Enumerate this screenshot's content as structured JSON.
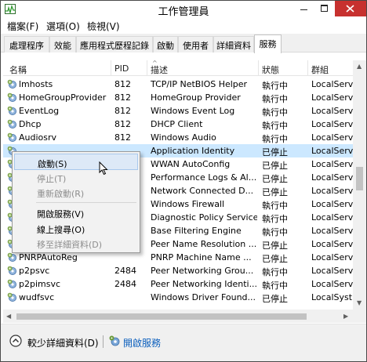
{
  "window": {
    "title": "工作管理員"
  },
  "menu": [
    "檔案(F)",
    "選項(O)",
    "檢視(V)"
  ],
  "tabs": [
    "處理程序",
    "效能",
    "應用程式歷程記錄",
    "啟動",
    "使用者",
    "詳細資料",
    "服務"
  ],
  "active_tab": "服務",
  "columns": {
    "name": "名稱",
    "pid": "PID",
    "description": "描述",
    "status": "狀態",
    "group": "群組"
  },
  "services": [
    {
      "name": "lmhosts",
      "pid": "812",
      "description": "TCP/IP NetBIOS Helper",
      "status": "執行中",
      "group": "LocalServi"
    },
    {
      "name": "HomeGroupProvider",
      "pid": "812",
      "description": "HomeGroup Provider",
      "status": "執行中",
      "group": "LocalServi"
    },
    {
      "name": "EventLog",
      "pid": "812",
      "description": "Windows Event Log",
      "status": "執行中",
      "group": "LocalServi"
    },
    {
      "name": "Dhcp",
      "pid": "812",
      "description": "DHCP Client",
      "status": "執行中",
      "group": "LocalServi"
    },
    {
      "name": "Audiosrv",
      "pid": "812",
      "description": "Windows Audio",
      "status": "執行中",
      "group": "LocalServi"
    },
    {
      "name": "",
      "pid": "",
      "description": "Application Identity",
      "status": "已停止",
      "group": "LocalServi"
    },
    {
      "name": "",
      "pid": "",
      "description": "WWAN AutoConfig",
      "status": "已停止",
      "group": "LocalServi"
    },
    {
      "name": "",
      "pid": "",
      "description": "Performance Logs & Al...",
      "status": "已停止",
      "group": "LocalServi"
    },
    {
      "name": "",
      "pid": "",
      "description": "Network Connected D...",
      "status": "已停止",
      "group": "LocalServi"
    },
    {
      "name": "",
      "pid": "",
      "description": "Windows Firewall",
      "status": "執行中",
      "group": "LocalServi"
    },
    {
      "name": "",
      "pid": "",
      "description": "Diagnostic Policy Service",
      "status": "執行中",
      "group": "LocalServi"
    },
    {
      "name": "",
      "pid": "",
      "description": "Base Filtering Engine",
      "status": "執行中",
      "group": "LocalServi"
    },
    {
      "name": "",
      "pid": "",
      "description": "Peer Name Resolution ...",
      "status": "已停止",
      "group": "LocalServi"
    },
    {
      "name": "PNRPAutoReg",
      "pid": "",
      "description": "PNRP Machine Name ...",
      "status": "已停止",
      "group": "LocalServi"
    },
    {
      "name": "p2psvc",
      "pid": "2484",
      "description": "Peer Networking Grou...",
      "status": "執行中",
      "group": "LocalServi"
    },
    {
      "name": "p2pimsvc",
      "pid": "2484",
      "description": "Peer Networking Identi...",
      "status": "執行中",
      "group": "LocalServi"
    },
    {
      "name": "wudfsvc",
      "pid": "",
      "description": "Windows Driver Found...",
      "status": "已停止",
      "group": "LocalSyst..."
    }
  ],
  "selected_row_index": 5,
  "context_menu": {
    "items": [
      {
        "label": "啟動(S)",
        "enabled": true,
        "highlighted": true
      },
      {
        "label": "停止(T)",
        "enabled": false
      },
      {
        "label": "重新啟動(R)",
        "enabled": false
      },
      {
        "label": "開啟服務(V)",
        "enabled": true
      },
      {
        "label": "線上搜尋(O)",
        "enabled": true
      },
      {
        "label": "移至詳細資料(D)",
        "enabled": false
      }
    ]
  },
  "footer": {
    "fewer_details": "較少詳細資料(D)",
    "open_services": "開啟服務"
  },
  "colors": {
    "selection": "#cce8ff",
    "close_button": "#c7312f",
    "link": "#0a5ebd",
    "menu_hover": "#dde9f7"
  },
  "icons": {
    "app": "task-manager-icon",
    "service": "gear-icon",
    "fewer_details": "chevron-up-circle-icon",
    "open_services": "gear-icon",
    "cursor": "mouse-pointer-icon"
  }
}
